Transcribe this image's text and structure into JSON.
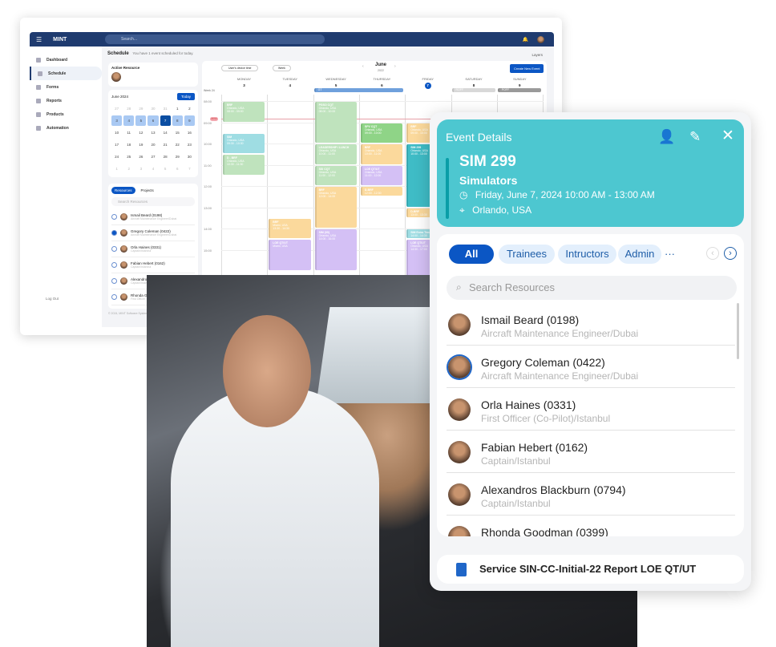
{
  "app": {
    "logo": "MINT",
    "logo_sub": "Software Systems",
    "search_placeholder": "Search...",
    "sidebar": [
      {
        "label": "Dashboard"
      },
      {
        "label": "Schedule",
        "active": true
      },
      {
        "label": "Forms"
      },
      {
        "label": "Reports"
      },
      {
        "label": "Products"
      },
      {
        "label": "Automation"
      }
    ],
    "logout": "Log Out",
    "page_title": "Schedule",
    "page_subtitle": "You have 1 event scheduled for today.",
    "layers": "Layers",
    "active_resource": "Active Resource",
    "mini_cal": {
      "month": "June 2024",
      "today": "Today",
      "days": [
        [
          "27",
          "o"
        ],
        [
          "28",
          "o"
        ],
        [
          "29",
          "o"
        ],
        [
          "30",
          "o"
        ],
        [
          "31",
          "o"
        ],
        [
          "1",
          ""
        ],
        [
          "2",
          ""
        ],
        [
          "3",
          "w"
        ],
        [
          "4",
          "w"
        ],
        [
          "5",
          "w"
        ],
        [
          "6",
          "w"
        ],
        [
          "7",
          "t"
        ],
        [
          "8",
          "w"
        ],
        [
          "9",
          "w"
        ],
        [
          "10",
          ""
        ],
        [
          "11",
          ""
        ],
        [
          "12",
          ""
        ],
        [
          "13",
          ""
        ],
        [
          "14",
          ""
        ],
        [
          "15",
          ""
        ],
        [
          "16",
          ""
        ],
        [
          "17",
          ""
        ],
        [
          "18",
          ""
        ],
        [
          "19",
          ""
        ],
        [
          "20",
          ""
        ],
        [
          "21",
          ""
        ],
        [
          "22",
          ""
        ],
        [
          "23",
          ""
        ],
        [
          "24",
          ""
        ],
        [
          "25",
          ""
        ],
        [
          "26",
          ""
        ],
        [
          "27",
          ""
        ],
        [
          "28",
          ""
        ],
        [
          "29",
          ""
        ],
        [
          "30",
          ""
        ],
        [
          "1",
          "o"
        ],
        [
          "2",
          "o"
        ],
        [
          "3",
          "o"
        ],
        [
          "4",
          "o"
        ],
        [
          "5",
          "o"
        ],
        [
          "6",
          "o"
        ],
        [
          "7",
          "o"
        ]
      ]
    },
    "tabs": [
      "Resources",
      "Projects"
    ],
    "res_search": "Search Resources",
    "resources": [
      {
        "name": "Ismail Beard (0198)",
        "role": "Aircraft Maintenance Engineer/Dubai",
        "checked": false
      },
      {
        "name": "Gregory Coleman (0422)",
        "role": "Aircraft Maintenance Engineer/Dubai",
        "checked": true
      },
      {
        "name": "Orla Haines (0331)",
        "role": "Captain/Istanbul",
        "checked": false
      },
      {
        "name": "Fabian Hebert (0162)",
        "role": "Captain/Istanbul",
        "checked": false
      },
      {
        "name": "Alexandros Blackburn (0794)",
        "role": "Captain/Istanbul",
        "checked": false
      },
      {
        "name": "Rhonda Goodman (0399)",
        "role": "First Officer",
        "checked": false
      }
    ],
    "footer": "© 2024, MINT Software Systems",
    "timezone": "User's device time",
    "view": "Week",
    "month": "June",
    "year": "2022",
    "create": "Create New Event",
    "week_label": "Week 24",
    "days": [
      {
        "name": "MONDAY",
        "num": "3"
      },
      {
        "name": "TUESDAY",
        "num": "4"
      },
      {
        "name": "WEDNESDAY",
        "num": "5"
      },
      {
        "name": "THURSDAY",
        "num": "6"
      },
      {
        "name": "FRIDAY",
        "num": "7",
        "today": true
      },
      {
        "name": "SATURDAY",
        "num": "8"
      },
      {
        "name": "SUNDAY",
        "num": "9"
      }
    ],
    "hours": [
      "08:00",
      "09:00",
      "10:00",
      "11:00",
      "12:00",
      "13:00",
      "14:00",
      "15:00"
    ],
    "now": "08:50",
    "allday": [
      {
        "label": "GT",
        "from": 2,
        "to": 3,
        "color": "#6fa0dc"
      },
      {
        "label": "ROFF",
        "from": 5,
        "to": 5,
        "color": "#d8d8d8"
      },
      {
        "label": "POFF",
        "from": 6,
        "to": 6,
        "color": "#9a9a9a"
      }
    ],
    "events": [
      {
        "day": 0,
        "start": 8,
        "end": 9,
        "title": "BRF",
        "loc": "Orlando, USA",
        "time": "08:00 - 09:00",
        "color": "#bfe3bd"
      },
      {
        "day": 0,
        "start": 9.5,
        "end": 10.5,
        "title": "SIM",
        "loc": "Orlando, USA",
        "time": "09:30 - 10:30",
        "color": "#9fdde3"
      },
      {
        "day": 0,
        "start": 10.5,
        "end": 11.5,
        "title": "D - BRF",
        "loc": "Orlando, USA",
        "time": "10:30 - 11:30",
        "color": "#bfe3bd"
      },
      {
        "day": 1,
        "start": 13.5,
        "end": 14.5,
        "title": "BRF",
        "loc": "Miami, USA",
        "time": "13:30 - 14:30",
        "color": "#fbd99c"
      },
      {
        "day": 1,
        "start": 14.5,
        "end": 16,
        "title": "LOE QT/UT",
        "loc": "Miami, USA",
        "time": "",
        "color": "#d4c0f5"
      },
      {
        "day": 2,
        "start": 8,
        "end": 10,
        "title": "PGSO CQT",
        "loc": "Orlando, USA",
        "time": "08:00 - 10:00",
        "color": "#bfe3bd"
      },
      {
        "day": 2,
        "start": 10,
        "end": 11,
        "title": "LEADERSHIP / LUNCH",
        "loc": "Orlando, USA",
        "time": "10:00 - 11:00",
        "color": "#bfe3bd"
      },
      {
        "day": 2,
        "start": 11,
        "end": 12,
        "title": "SSI CQT",
        "loc": "Orlando, USA",
        "time": "11:00 - 12:00",
        "color": "#bfe3bd"
      },
      {
        "day": 2,
        "start": 12,
        "end": 14,
        "title": "BRF",
        "loc": "Orlando, USA",
        "time": "12:00 - 14:00",
        "color": "#fbd99c"
      },
      {
        "day": 2,
        "start": 14,
        "end": 16,
        "title": "SIM (00)",
        "loc": "Orlando, USA",
        "time": "14:00 - 16:00",
        "color": "#d4c0f5"
      },
      {
        "day": 3,
        "start": 9,
        "end": 10,
        "title": "SPV CQT",
        "loc": "Orlando, USA",
        "time": "09:00 - 10:00",
        "color": "#8fd487"
      },
      {
        "day": 3,
        "start": 10,
        "end": 11,
        "title": "BRF",
        "loc": "Orlando, USA",
        "time": "10:00 - 11:00",
        "color": "#fbd99c"
      },
      {
        "day": 3,
        "start": 11,
        "end": 12,
        "title": "LOE QT/UT",
        "loc": "Orlando, USA",
        "time": "11:00 - 12:00",
        "color": "#d4c0f5"
      },
      {
        "day": 3,
        "start": 12,
        "end": 12.5,
        "title": "D-BRF",
        "loc": "",
        "time": "12:00 - 12:30",
        "color": "#fbd99c"
      },
      {
        "day": 4,
        "start": 9,
        "end": 10,
        "title": "BRF",
        "loc": "Orlando, USA",
        "time": "09:00 - 10:00",
        "color": "#fbd99c"
      },
      {
        "day": 4,
        "start": 10,
        "end": 13,
        "title": "SIM 299",
        "loc": "Orlando, USA",
        "time": "10:00 - 13:00",
        "color": "#3fbcc6"
      },
      {
        "day": 4,
        "start": 13,
        "end": 13.5,
        "title": "D-BRF",
        "loc": "",
        "time": "13:00 - 13:30",
        "color": "#fbd99c"
      },
      {
        "day": 4,
        "start": 14,
        "end": 14.5,
        "title": "SIM Extra Time",
        "loc": "",
        "time": "14:00 - 14:30",
        "color": "#9fdde3"
      },
      {
        "day": 4,
        "start": 14.5,
        "end": 17,
        "title": "LOE QT/UT",
        "loc": "Orlando, USA",
        "time": "14:30 - 17:00",
        "color": "#d4c0f5"
      }
    ]
  },
  "details": {
    "title": "Event Details",
    "code": "SIM 299",
    "category": "Simulators",
    "datetime": "Friday, June 7, 2024 10:00 AM - 13:00 AM",
    "location": "Orlando, USA",
    "filters": [
      "All",
      "Trainees",
      "Intructors",
      "Admin"
    ],
    "more": "···",
    "search_placeholder": "Search Resources",
    "people": [
      {
        "name": "Ismail Beard (0198)",
        "role": "Aircraft Maintenance Engineer/Dubai"
      },
      {
        "name": "Gregory Coleman (0422)",
        "role": "Aircraft Maintenance Engineer/Dubai"
      },
      {
        "name": "Orla Haines (0331)",
        "role": "First Officer (Co-Pilot)/Istanbul"
      },
      {
        "name": "Fabian Hebert (0162)",
        "role": "Captain/Istanbul"
      },
      {
        "name": "Alexandros Blackburn (0794)",
        "role": "Captain/Istanbul"
      },
      {
        "name": "Rhonda Goodman (0399)",
        "role": ""
      }
    ],
    "report": "Service SIN-CC-Initial-22 Report LOE QT/UT",
    "accent": "#4dc7d0",
    "primary": "#0b56c4"
  }
}
